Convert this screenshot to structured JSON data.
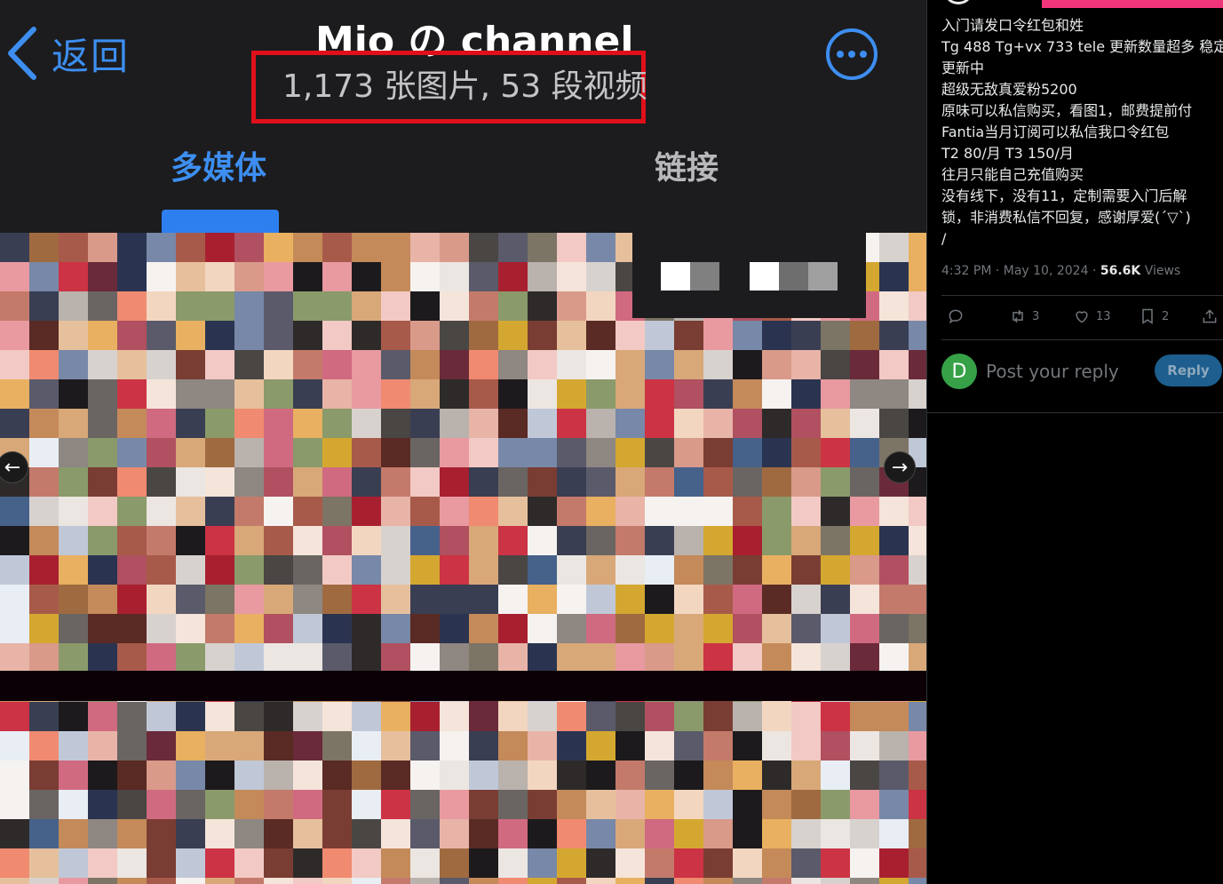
{
  "viewer": {
    "back_label": "返回",
    "channel_title": "Mio の channel",
    "media_count": "1,173 张图片, 53 段视频",
    "tabs": [
      {
        "label": "多媒体",
        "active": true
      },
      {
        "label": "链接",
        "active": false
      }
    ],
    "accent_color": "#3d8ef0",
    "highlight_box_color": "#e0101a",
    "icons": {
      "back": "chevron-left-icon",
      "more": "more-horizontal-icon",
      "prev": "arrow-left-icon",
      "next": "arrow-right-icon"
    }
  },
  "tweet": {
    "lines": [
      "入门请发口令红包和姓",
      "Tg 488 Tg+vx 733  tele 更新数量超多 稳定",
      "更新中",
      "超级无敌真爱粉5200",
      "原味可以私信购买，看图1，邮费提前付",
      "Fantia当月订阅可以私信我口令红包",
      "T2 80/月 T3 150/月",
      "往月只能自己充值购买",
      "没有线下，没有11，定制需要入门后解",
      "锁，非消费私信不回复，感谢厚爱(ˊ▽ˋ)",
      "/"
    ],
    "timestamp": "4:32 PM · May 10, 2024 · ",
    "views_count": "56.6K",
    "views_label": " Views",
    "actions": {
      "replies": "",
      "retweets": "3",
      "likes": "13",
      "bookmarks": "2"
    },
    "reply": {
      "avatar_letter": "D",
      "avatar_color": "#36a147",
      "placeholder": "Post your reply",
      "button_label": "Reply"
    }
  }
}
